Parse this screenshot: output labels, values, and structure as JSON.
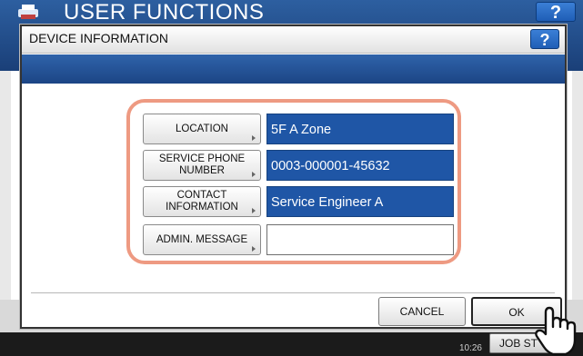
{
  "app": {
    "title": "USER FUNCTIONS",
    "help_label": "?",
    "clock": "10:26",
    "job_status_label": "JOB ST"
  },
  "dialog": {
    "title": "DEVICE INFORMATION",
    "help_label": "?",
    "fields": [
      {
        "label": "LOCATION",
        "value": "5F A Zone"
      },
      {
        "label": "SERVICE PHONE NUMBER",
        "value": "0003-000001-45632"
      },
      {
        "label": "CONTACT INFORMATION",
        "value": "Service Engineer A"
      },
      {
        "label": "ADMIN. MESSAGE",
        "value": ""
      }
    ],
    "cancel_label": "CANCEL",
    "ok_label": "OK"
  },
  "colors": {
    "accent_blue": "#1f56a6",
    "header_blue": "#2d5fa0",
    "highlight_ring": "#ee9a82"
  },
  "icons": [
    "printer-logo-icon",
    "help-icon",
    "chevron-right-icon",
    "hand-pointer-icon"
  ]
}
